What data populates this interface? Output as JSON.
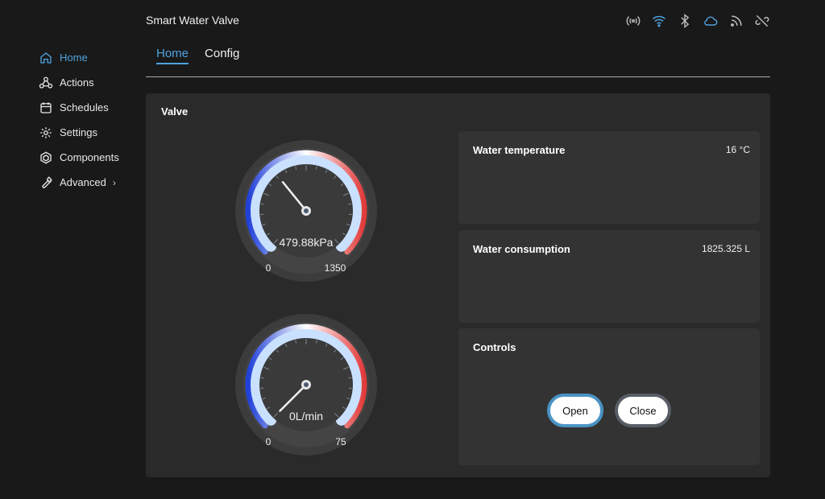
{
  "app": {
    "title": "Smart Water Valve"
  },
  "status_icons": [
    "radio-signal-icon",
    "wifi-icon",
    "bluetooth-icon",
    "cloud-icon",
    "rss-icon",
    "link-off-icon"
  ],
  "sidebar": {
    "items": [
      {
        "label": "Home",
        "icon": "home-icon",
        "active": true
      },
      {
        "label": "Actions",
        "icon": "actions-icon"
      },
      {
        "label": "Schedules",
        "icon": "calendar-icon"
      },
      {
        "label": "Settings",
        "icon": "gear-icon"
      },
      {
        "label": "Components",
        "icon": "components-icon"
      },
      {
        "label": "Advanced",
        "icon": "wrench-icon",
        "chevron": "›"
      }
    ]
  },
  "tabs": [
    {
      "label": "Home",
      "active": true
    },
    {
      "label": "Config"
    }
  ],
  "card": {
    "title": "Valve"
  },
  "gauges": [
    {
      "name": "pressure",
      "value": 479.88,
      "min": 0,
      "max": 1350,
      "display": "479.88kPa",
      "min_label": "0",
      "max_label": "1350"
    },
    {
      "name": "flow",
      "value": 0,
      "min": 0,
      "max": 75,
      "display": "0L/min",
      "min_label": "0",
      "max_label": "75"
    }
  ],
  "panels": {
    "temperature": {
      "title": "Water temperature",
      "value": "16 °C"
    },
    "consumption": {
      "title": "Water consumption",
      "value": "1825.325 L"
    },
    "controls": {
      "title": "Controls",
      "open_label": "Open",
      "close_label": "Close"
    }
  },
  "colors": {
    "accent": "#4fa3e0",
    "gauge_low": "#2140d8",
    "gauge_high": "#e23a3a",
    "gauge_face": "#c9e0ff"
  }
}
